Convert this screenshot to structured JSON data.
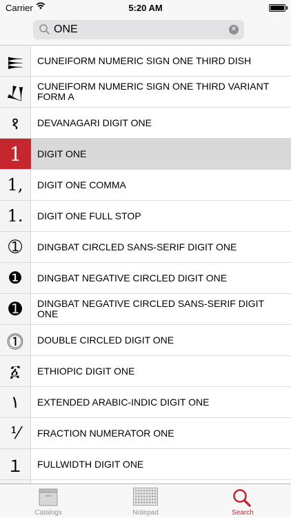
{
  "status": {
    "carrier": "Carrier",
    "time": "5:20 AM"
  },
  "search": {
    "query": "ONE"
  },
  "colors": {
    "accent": "#c6262e",
    "selected_row": "#d9d9d9"
  },
  "rows": [
    {
      "glyph": "𒐺",
      "name": "CUNEIFORM NUMERIC SIGN ONE THIRD DISH"
    },
    {
      "glyph": "𒑚",
      "name": "CUNEIFORM NUMERIC SIGN ONE THIRD VARIANT FORM A"
    },
    {
      "glyph": "१",
      "name": "DEVANAGARI DIGIT ONE"
    },
    {
      "glyph": "1",
      "name": "DIGIT ONE",
      "selected": true
    },
    {
      "glyph": "1,",
      "name": "DIGIT ONE COMMA"
    },
    {
      "glyph": "1.",
      "name": "DIGIT ONE FULL STOP"
    },
    {
      "glyph": "➀",
      "name": "DINGBAT CIRCLED SANS-SERIF DIGIT ONE"
    },
    {
      "glyph": "❶",
      "name": "DINGBAT NEGATIVE CIRCLED DIGIT ONE"
    },
    {
      "glyph": "➊",
      "name": "DINGBAT NEGATIVE CIRCLED SANS-SERIF DIGIT ONE"
    },
    {
      "glyph": "⓵",
      "name": "DOUBLE CIRCLED DIGIT ONE"
    },
    {
      "glyph": "፩",
      "name": "ETHIOPIC DIGIT ONE"
    },
    {
      "glyph": "۱",
      "name": "EXTENDED ARABIC-INDIC DIGIT ONE"
    },
    {
      "glyph": "⅟",
      "name": "FRACTION NUMERATOR ONE"
    },
    {
      "glyph": "１",
      "name": "FULLWIDTH DIGIT ONE"
    },
    {
      "glyph": "",
      "name": ""
    }
  ],
  "tabs": [
    {
      "label": "Catalogs",
      "icon": "catalogs-icon"
    },
    {
      "label": "Notepad",
      "icon": "notepad-icon"
    },
    {
      "label": "Search",
      "icon": "search-icon",
      "active": true
    }
  ]
}
